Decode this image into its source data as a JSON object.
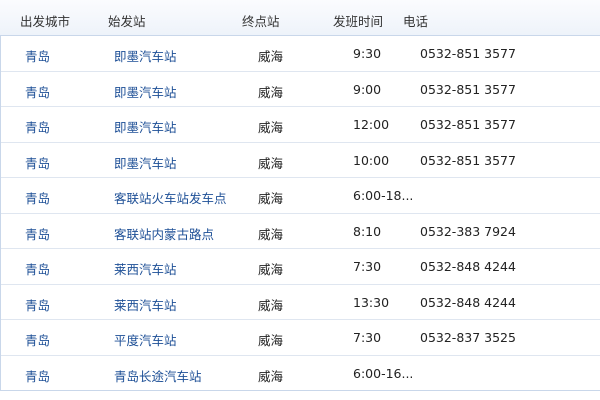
{
  "header": {
    "city": "出发城市",
    "departure_station": "始发站",
    "destination": "终点站",
    "time": "发班时间",
    "phone": "电话"
  },
  "rows": [
    {
      "city": "青岛",
      "station": "即墨汽车站",
      "dest": "威海",
      "time": "9:30",
      "phone": "0532-851 3577"
    },
    {
      "city": "青岛",
      "station": "即墨汽车站",
      "dest": "威海",
      "time": "9:00",
      "phone": "0532-851 3577"
    },
    {
      "city": "青岛",
      "station": "即墨汽车站",
      "dest": "威海",
      "time": "12:00",
      "phone": "0532-851 3577"
    },
    {
      "city": "青岛",
      "station": "即墨汽车站",
      "dest": "威海",
      "time": "10:00",
      "phone": "0532-851 3577"
    },
    {
      "city": "青岛",
      "station": "客联站火车站发车点",
      "dest": "威海",
      "time": "6:00-18...",
      "phone": ""
    },
    {
      "city": "青岛",
      "station": "客联站内蒙古路点",
      "dest": "威海",
      "time": "8:10",
      "phone": "0532-383 7924"
    },
    {
      "city": "青岛",
      "station": "莱西汽车站",
      "dest": "威海",
      "time": "7:30",
      "phone": "0532-848 4244"
    },
    {
      "city": "青岛",
      "station": "莱西汽车站",
      "dest": "威海",
      "time": "13:30",
      "phone": "0532-848 4244"
    },
    {
      "city": "青岛",
      "station": "平度汽车站",
      "dest": "威海",
      "time": "7:30",
      "phone": "0532-837 3525"
    },
    {
      "city": "青岛",
      "station": "青岛长途汽车站",
      "dest": "威海",
      "time": "6:00-16...",
      "phone": ""
    }
  ]
}
